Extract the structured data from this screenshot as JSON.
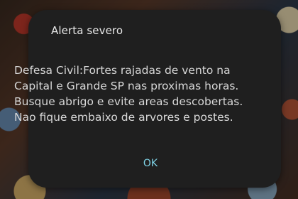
{
  "dialog": {
    "title": "Alerta severo",
    "message_lines": [
      "Defesa Civil:Fortes rajadas de vento na",
      "Capital e Grande SP nas proximas horas.",
      "Busque abrigo e evite areas descobertas.",
      "Nao fique embaixo de arvores e postes."
    ],
    "ok_label": "OK"
  },
  "colors": {
    "dialog_background": "#1f1f1f",
    "title_text": "#e8e8e8",
    "body_text": "#d8d8d8",
    "accent": "#7fd3e6"
  }
}
